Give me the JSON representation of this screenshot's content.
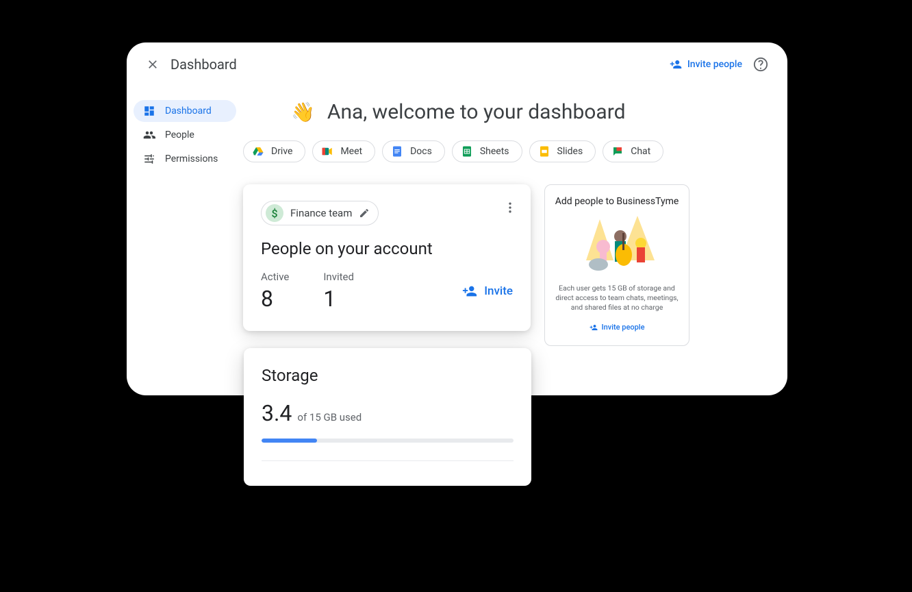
{
  "topbar": {
    "title": "Dashboard",
    "invite_label": "Invite people"
  },
  "sidebar": {
    "items": [
      {
        "label": "Dashboard"
      },
      {
        "label": "People"
      },
      {
        "label": "Permissions"
      }
    ]
  },
  "welcome": {
    "emoji": "👋",
    "text": "Ana, welcome to your dashboard"
  },
  "apps": [
    {
      "name": "Drive"
    },
    {
      "name": "Meet"
    },
    {
      "name": "Docs"
    },
    {
      "name": "Sheets"
    },
    {
      "name": "Slides"
    },
    {
      "name": "Chat"
    }
  ],
  "people_card": {
    "team_name": "Finance team",
    "title": "People on your account",
    "active_label": "Active",
    "active_value": "8",
    "invited_label": "Invited",
    "invited_value": "1",
    "invite_label": "Invite"
  },
  "promo_card": {
    "title": "Add people to BusinessTyme",
    "description": "Each user gets 15 GB of storage and direct access to team chats, meetings, and shared files at no charge",
    "link_label": "Invite people"
  },
  "storage_card": {
    "title": "Storage",
    "used_value": "3.4",
    "used_suffix": "of 15 GB used",
    "percent": 22
  }
}
